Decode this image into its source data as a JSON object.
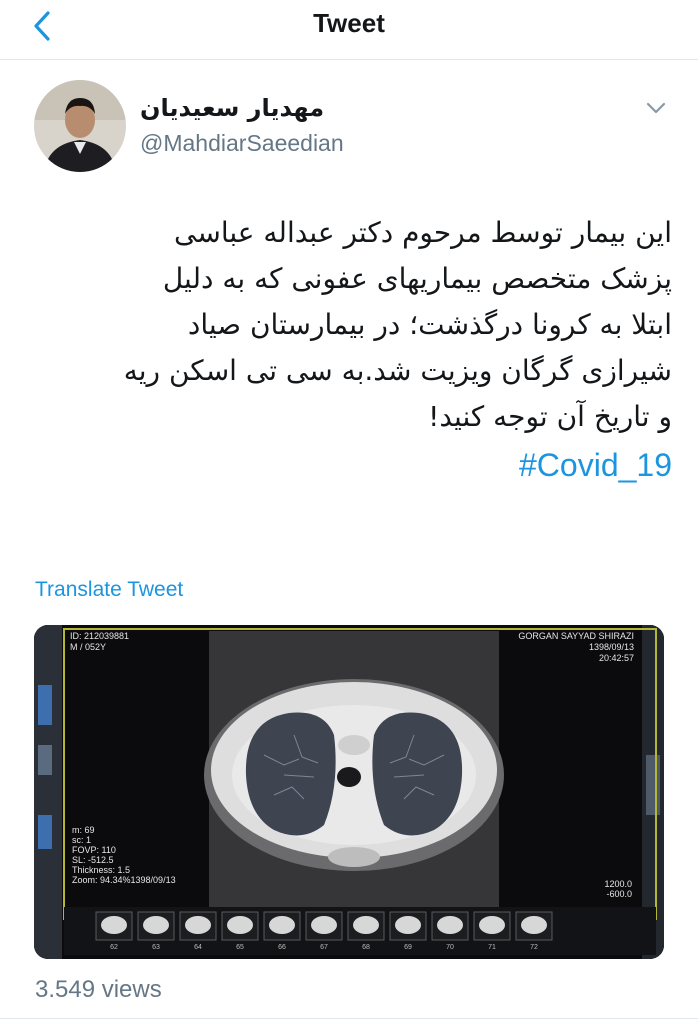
{
  "nav": {
    "title": "Tweet",
    "back_icon": "chevron-left-icon"
  },
  "author": {
    "display_name": "مهدیار سعیدیان",
    "handle": "@MahdiarSaeedian"
  },
  "tweet": {
    "lines": [
      "این بیمار توسط مرحوم دکتر عبداله عباسی",
      "پزشک متخصص بیماریهای عفونی که به دلیل",
      "ابتلا به کرونا درگذشت؛ در بیمارستان صیاد",
      "شیرازی گرگان ویزیت شد.به سی تی اسکن ریه",
      "و تاریخ آن توجه کنید!"
    ],
    "hashtag": "#Covid_19"
  },
  "translate_label": "Translate Tweet",
  "media": {
    "top_left": [
      "ID: 212039881",
      "M / 052Y"
    ],
    "top_right": [
      "GORGAN SAYYAD SHIRAZI",
      "1398/09/13",
      "20:42:57"
    ],
    "bottom_left": [
      "m: 69",
      "sc: 1",
      "FOVP: 110",
      "SL: -512.5",
      "Thickness: 1.5",
      "Zoom: 94.34%1398/09/13"
    ],
    "bottom_right": [
      "1200.0",
      "-600.0"
    ],
    "thumb_labels": [
      "62",
      "63",
      "64",
      "65",
      "66",
      "67",
      "68",
      "69",
      "70",
      "71",
      "72"
    ]
  },
  "views": "3.549 views",
  "colors": {
    "link": "#1b95e0",
    "secondary": "#657786",
    "text": "#14171a"
  }
}
